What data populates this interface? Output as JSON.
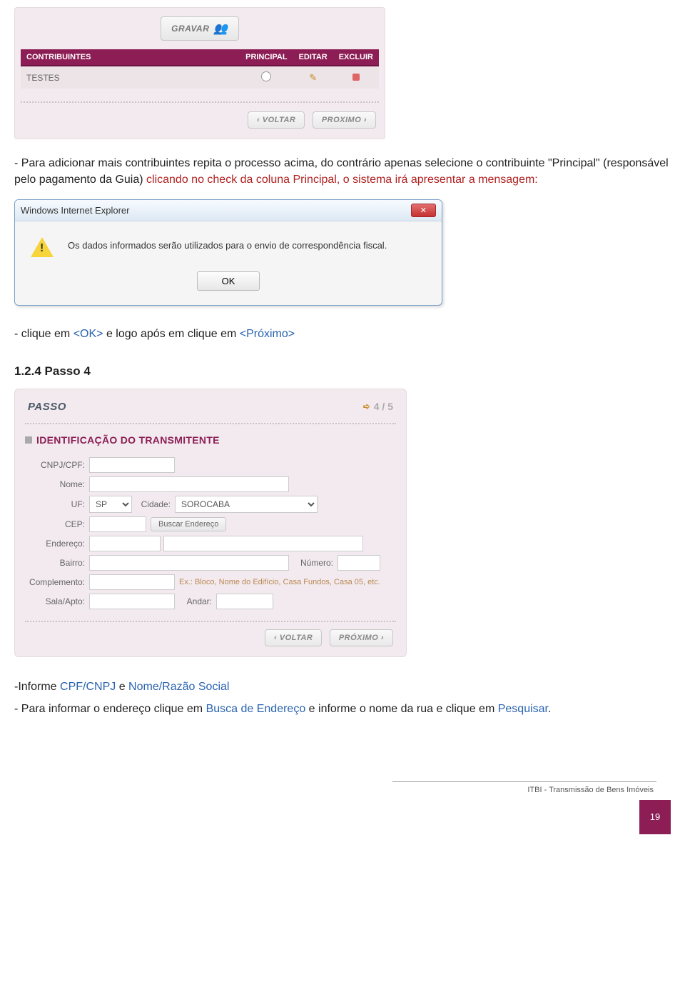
{
  "contrib": {
    "gravar_label": "GRAVAR",
    "headers": {
      "contribuintes": "CONTRIBUINTES",
      "principal": "PRINCIPAL",
      "editar": "EDITAR",
      "excluir": "EXCLUIR"
    },
    "row1_name": "TESTES",
    "voltar": "‹  VOLTAR",
    "proximo": "PROXIMO  ›"
  },
  "para1_a": "- Para adicionar mais contribuintes repita o processo acima, do contrário apenas selecione o contribuinte \"Principal\" (responsável pelo pagamento da Guia) ",
  "para1_b": "clicando no check da coluna Principal, o sistema irá apresentar a mensagem:",
  "dialog": {
    "title": "Windows Internet Explorer",
    "close": "✕",
    "msg": "Os dados informados serão utilizados para o envio de correspondência fiscal.",
    "ok": "OK"
  },
  "para2_a": "- clique em ",
  "para2_ok": "<OK>",
  "para2_b": " e logo após em clique em ",
  "para2_prox": "<Próximo>",
  "sect_title": "1.2.4 Passo 4",
  "form4": {
    "passo": "PASSO",
    "step": "4 / 5",
    "ident_title": "IDENTIFICAÇÃO DO TRANSMITENTE",
    "labels": {
      "cnpjcpf": "CNPJ/CPF:",
      "nome": "Nome:",
      "uf": "UF:",
      "cidade": "Cidade:",
      "cep": "CEP:",
      "buscar": "Buscar Endereço",
      "endereco": "Endereço:",
      "bairro": "Bairro:",
      "numero": "Número:",
      "complemento": "Complemento:",
      "hint": "Ex.: Bloco, Nome do Edifício, Casa Fundos, Casa 05, etc.",
      "sala": "Sala/Apto:",
      "andar": "Andar:"
    },
    "uf_value": "SP",
    "cidade_value": "SOROCABA",
    "voltar": "‹  VOLTAR",
    "proximo": "PRÓXIMO  ›"
  },
  "para3_a": "-Informe ",
  "para3_cpf": "CPF/CNPJ",
  "para3_b": " e ",
  "para3_nome": "Nome/Razão Social",
  "para4_a": "- Para informar o endereço clique em ",
  "para4_busca": "Busca de Endereço",
  "para4_b": " e informe o nome da rua e clique em ",
  "para4_pesq": "Pesquisar",
  "para4_c": ".",
  "footer_txt": "ITBI - Transmissão de Bens Imóveis",
  "page_num": "19"
}
